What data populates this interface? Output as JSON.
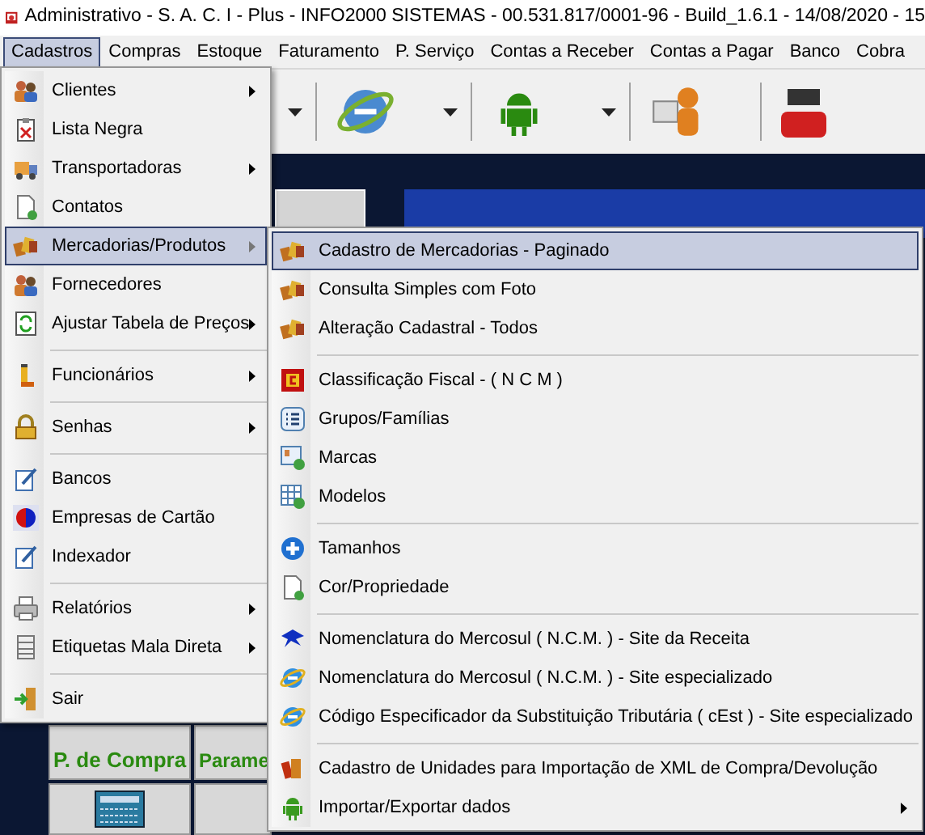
{
  "window": {
    "title": "Administrativo - S. A. C. I - Plus - INFO2000 SISTEMAS - 00.531.817/0001-96 - Build_1.6.1 - 14/08/2020 - 15"
  },
  "menu_bar": [
    {
      "label": "Cadastros",
      "selected": true
    },
    {
      "label": "Compras",
      "selected": false
    },
    {
      "label": "Estoque",
      "selected": false
    },
    {
      "label": "Faturamento",
      "selected": false
    },
    {
      "label": "P. Serviço",
      "selected": false
    },
    {
      "label": "Contas a Receber",
      "selected": false
    },
    {
      "label": "Contas a Pagar",
      "selected": false
    },
    {
      "label": "Banco",
      "selected": false
    },
    {
      "label": "Cobra",
      "selected": false
    }
  ],
  "menu": {
    "items": [
      {
        "kind": "item",
        "label": "Clientes",
        "submenu": true,
        "selected": false
      },
      {
        "kind": "item",
        "label": "Lista Negra",
        "submenu": false,
        "selected": false
      },
      {
        "kind": "item",
        "label": "Transportadoras",
        "submenu": true,
        "selected": false
      },
      {
        "kind": "item",
        "label": "Contatos",
        "submenu": false,
        "selected": false
      },
      {
        "kind": "item",
        "label": "Mercadorias/Produtos",
        "submenu": true,
        "selected": true
      },
      {
        "kind": "item",
        "label": "Fornecedores",
        "submenu": false,
        "selected": false
      },
      {
        "kind": "item",
        "label": "Ajustar Tabela de Preços",
        "submenu": true,
        "selected": false
      },
      {
        "kind": "separator"
      },
      {
        "kind": "item",
        "label": "Funcionários",
        "submenu": true,
        "selected": false
      },
      {
        "kind": "separator"
      },
      {
        "kind": "item",
        "label": "Senhas",
        "submenu": true,
        "selected": false
      },
      {
        "kind": "separator"
      },
      {
        "kind": "item",
        "label": "Bancos",
        "submenu": false,
        "selected": false
      },
      {
        "kind": "item",
        "label": "Empresas de Cartão",
        "submenu": false,
        "selected": false
      },
      {
        "kind": "item",
        "label": "Indexador",
        "submenu": false,
        "selected": false
      },
      {
        "kind": "separator"
      },
      {
        "kind": "item",
        "label": "Relatórios",
        "submenu": true,
        "selected": false
      },
      {
        "kind": "item",
        "label": "Etiquetas Mala Direta",
        "submenu": true,
        "selected": false
      },
      {
        "kind": "separator"
      },
      {
        "kind": "item",
        "label": "Sair",
        "submenu": false,
        "selected": false
      }
    ]
  },
  "submenu": {
    "items": [
      {
        "kind": "item",
        "label": "Cadastro de Mercadorias - Paginado",
        "submenu": false,
        "selected": true
      },
      {
        "kind": "item",
        "label": "Consulta Simples com Foto",
        "submenu": false,
        "selected": false
      },
      {
        "kind": "item",
        "label": "Alteração Cadastral - Todos",
        "submenu": false,
        "selected": false
      },
      {
        "kind": "separator"
      },
      {
        "kind": "item",
        "label": "Classificação Fiscal - ( N C M )",
        "submenu": false,
        "selected": false
      },
      {
        "kind": "item",
        "label": "Grupos/Famílias",
        "submenu": false,
        "selected": false
      },
      {
        "kind": "item",
        "label": "Marcas",
        "submenu": false,
        "selected": false
      },
      {
        "kind": "item",
        "label": "Modelos",
        "submenu": false,
        "selected": false
      },
      {
        "kind": "separator"
      },
      {
        "kind": "item",
        "label": "Tamanhos",
        "submenu": false,
        "selected": false
      },
      {
        "kind": "item",
        "label": "Cor/Propriedade",
        "submenu": false,
        "selected": false
      },
      {
        "kind": "separator"
      },
      {
        "kind": "item",
        "label": "Nomenclatura do Mercosul ( N.C.M. ) - Site da Receita",
        "submenu": false,
        "selected": false
      },
      {
        "kind": "item",
        "label": "Nomenclatura do Mercosul ( N.C.M. ) - Site especializado",
        "submenu": false,
        "selected": false
      },
      {
        "kind": "item",
        "label": "Código Especificador da Substituição Tributária ( cEst ) - Site especializado",
        "submenu": false,
        "selected": false
      },
      {
        "kind": "separator"
      },
      {
        "kind": "item",
        "label": "Cadastro de Unidades para Importação de XML de Compra/Devolução",
        "submenu": false,
        "selected": false
      },
      {
        "kind": "item",
        "label": "Importar/Exportar dados",
        "submenu": true,
        "selected": false
      }
    ]
  },
  "tiles": [
    {
      "label": "P. de Compra"
    },
    {
      "label": "Parame"
    }
  ]
}
